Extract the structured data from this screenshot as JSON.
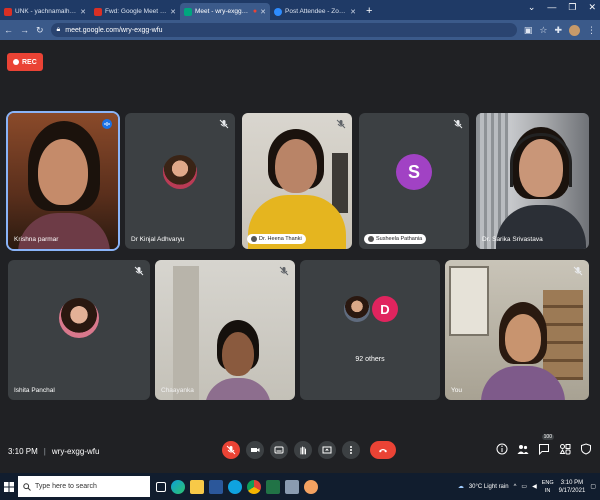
{
  "browser": {
    "tabs": [
      {
        "label": "UNK - yachnamalhotra@its.edu",
        "favicon_color": "#d93025",
        "active": false
      },
      {
        "label": "Fwd: Google Meet Link for tom",
        "favicon_color": "#d93025",
        "active": false
      },
      {
        "label": "Meet - wry-exgg-wfu",
        "favicon_color": "#00a67e",
        "active": true
      },
      {
        "label": "Post Attendee - Zoom",
        "favicon_color": "#2d8cff",
        "active": false
      }
    ],
    "new_tab_label": "+",
    "url": "meet.google.com/wry-exgg-wfu"
  },
  "meet": {
    "rec_label": "REC",
    "participants": [
      {
        "name": "Krishna parmar",
        "muted": false,
        "speaking": true,
        "type": "video"
      },
      {
        "name": "Dr Kinjal Adhvaryu",
        "muted": true,
        "type": "photo"
      },
      {
        "name": "Dr. Heena Thanki",
        "muted": true,
        "type": "video"
      },
      {
        "name": "Susheela Pathania",
        "muted": true,
        "type": "letter",
        "letter": "S",
        "color": "#a142c4"
      },
      {
        "name": "Dr. Sarika Srivastava",
        "muted": false,
        "type": "video"
      },
      {
        "name": "Ishita Panchal",
        "muted": true,
        "type": "photo"
      },
      {
        "name": "Chaayanka",
        "muted": true,
        "type": "video"
      },
      {
        "name": "92 others",
        "muted": false,
        "type": "others",
        "letter": "D",
        "color": "#e0245e"
      },
      {
        "name": "You",
        "muted": true,
        "type": "video"
      }
    ],
    "time": "3:10 PM",
    "separator": "|",
    "meeting_code": "wry-exgg-wfu",
    "people_count": "100"
  },
  "taskbar": {
    "search_placeholder": "Type here to search",
    "weather": "30°C  Light rain",
    "lang_1": "ENG",
    "lang_2": "IN",
    "time": "3:10 PM",
    "date": "9/17/2021"
  },
  "colors": {
    "meet_bg": "#202124",
    "tile_bg": "#3c4043",
    "accent_red": "#ea4335",
    "speaking_outline": "#8ab4f8"
  }
}
